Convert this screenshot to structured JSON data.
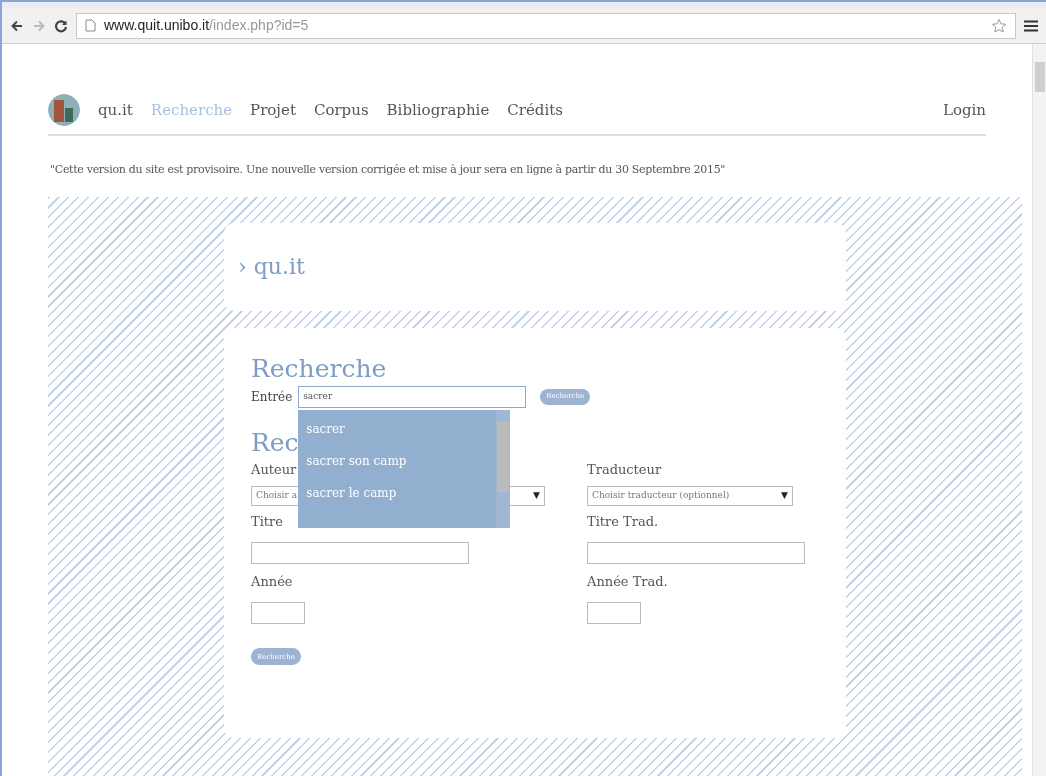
{
  "browser": {
    "url_host": "www.quit.unibo.it",
    "url_path": "/index.php?id=5"
  },
  "nav": {
    "brand": "qu.it",
    "items": [
      {
        "label": "Recherche",
        "selected": true
      },
      {
        "label": "Projet",
        "selected": false
      },
      {
        "label": "Corpus",
        "selected": false
      },
      {
        "label": "Bibliographie",
        "selected": false
      },
      {
        "label": "Crédits",
        "selected": false
      }
    ],
    "login": "Login"
  },
  "notice": "\"Cette version du site est provisoire. Une nouvelle version corrigée et mise à jour sera en ligne à partir du 30 Septembre 2015\"",
  "site_card": {
    "bullet": "›",
    "title": "qu.it"
  },
  "quick_search": {
    "heading": "Recherche",
    "label": "Entrée",
    "value": "sacrer",
    "button": "Recherche",
    "suggestions": [
      "sacrer",
      "sacrer son camp",
      "sacrer le camp"
    ]
  },
  "advanced_search": {
    "heading": "Rec",
    "author": {
      "label": "Auteur",
      "value": "Choisir a",
      "arrow": "▼"
    },
    "translator": {
      "label": "Traducteur",
      "value": "Choisir traducteur (optionnel)",
      "arrow": "▼"
    },
    "title": {
      "label": "Titre"
    },
    "title_trad": {
      "label": "Titre Trad."
    },
    "year": {
      "label": "Année"
    },
    "year_trad": {
      "label": "Année Trad."
    },
    "button": "Recherche"
  }
}
